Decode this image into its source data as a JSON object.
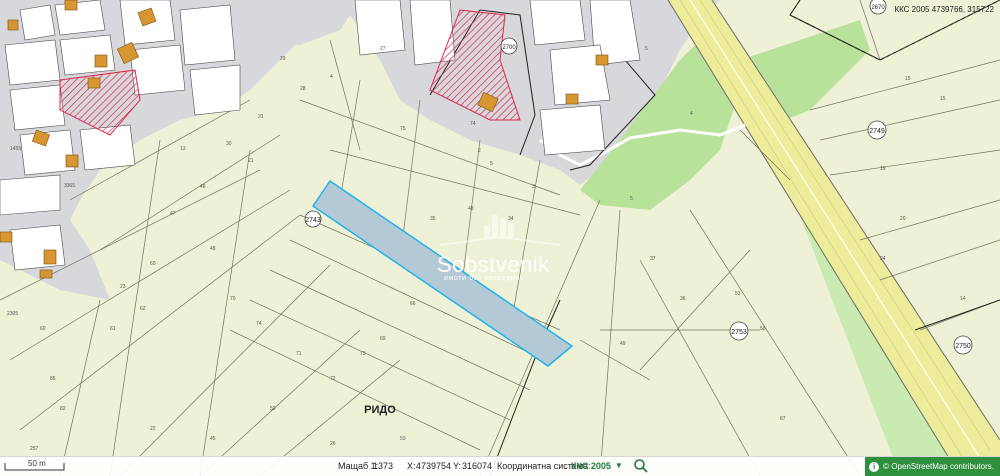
{
  "map": {
    "place_label": "РИДО",
    "parcel_ids": [
      "2743",
      "2749",
      "2753",
      "2750",
      "2700",
      "2670"
    ],
    "coordinate_readout": "ККС 2005 4739766, 315722",
    "colors": {
      "background": "#eef1d6",
      "urban_grey": "#d7d8db",
      "green_zone": "#b8e29a",
      "selected_parcel_fill": "#b3c9d6",
      "selected_parcel_stroke": "#1fb5ec",
      "building": "#d79632",
      "hatch": "#e0284a",
      "road": "#ecec9a",
      "road_edge": "#6d6d6d"
    }
  },
  "watermark": {
    "name": "Sobstvenik",
    "tagline": "имоти без посредник"
  },
  "status_bar": {
    "scale_label": "50 m",
    "scale_prefix": "Мащаб 1:",
    "scale_value": "1373",
    "x_label": "X:",
    "x_value": "4739754",
    "y_label": "Y:",
    "y_value": "316074",
    "crs_label": "Координатна система:",
    "crs_value": "ККС 2005",
    "search_icon": "search-icon",
    "attribution": "© OpenStreetMap contributors."
  }
}
